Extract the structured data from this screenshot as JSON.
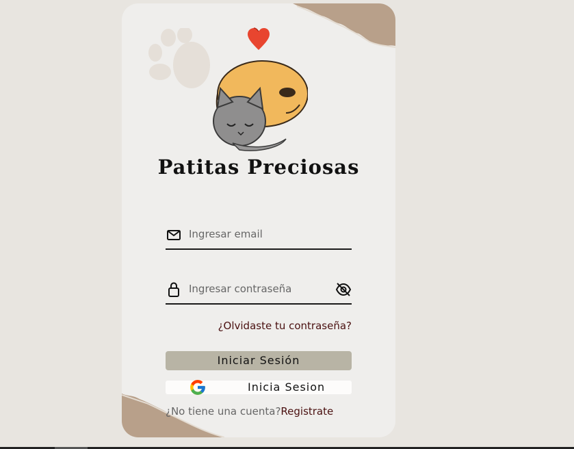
{
  "brand": {
    "name": "Patitas Preciosas"
  },
  "login": {
    "email_placeholder": "Ingresar email",
    "password_placeholder": "Ingresar contraseña",
    "forgot_label": "¿Olvidaste tu contraseña?",
    "submit_label": "Iniciar Sesión",
    "google_label": "Inicia Sesion",
    "signup_prompt": "¿No tiene una cuenta?",
    "signup_link": "Registrate"
  },
  "icons": {
    "email": "mail-icon",
    "password": "lock-icon",
    "visibility": "eye-off-icon",
    "google": "google-icon",
    "heart": "heart-icon",
    "paw": "paw-print-icon"
  },
  "colors": {
    "page_bg": "#e8e5e0",
    "card_bg": "#efeeec",
    "primary_button": "#b8b4a5",
    "link": "#4a1010",
    "heart": "#e8452f",
    "paper": "#b8a08a"
  }
}
